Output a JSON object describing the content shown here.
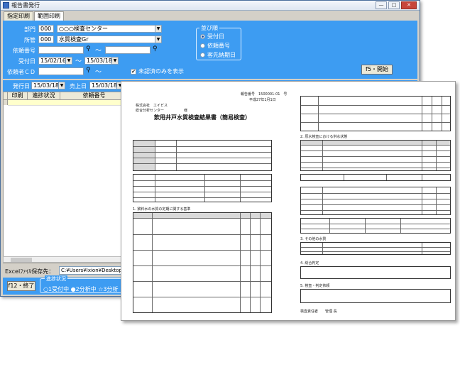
{
  "window": {
    "title": "報告書発行",
    "btn_min": "—",
    "btn_max": "□",
    "btn_close": "✕"
  },
  "tabs": [
    {
      "label": "指定印刷"
    },
    {
      "label": "範囲印刷"
    }
  ],
  "filters": {
    "dept_label": "部門",
    "dept_code": "000",
    "dept_name": "○○○検査センター",
    "section_label": "所管",
    "section_code": "000",
    "section_name": "水質検査Gr",
    "request_no_label": "依頼番号",
    "received_date_label": "受付日",
    "received_from": "15/02/16",
    "received_to": "15/03/18",
    "requester_cd_label": "依頼者ＣＤ",
    "unprinted_only_label": "未認済のみを表示",
    "unprinted_only_checked": "✔",
    "tilde": "〜"
  },
  "sort": {
    "caption": "並び順",
    "options": [
      {
        "label": "受付日",
        "selected": true
      },
      {
        "label": "依頼番号",
        "selected": false
      },
      {
        "label": "客先納期日",
        "selected": false
      }
    ]
  },
  "buttons": {
    "f5": "f5・開始",
    "f12": "f12・終了"
  },
  "strip": {
    "issue_label": "発行日",
    "issue_date": "15/03/18",
    "sales_label": "売上日",
    "sales_date": "15/03/18"
  },
  "grid": {
    "columns": [
      "印刷",
      "進捗状況",
      "依頼番号"
    ]
  },
  "excel": {
    "label": "Excelﾌｧｲﾙ保存先：",
    "path": "C:¥Users¥Ixion¥Desktop"
  },
  "progress": {
    "caption": "進捗状況",
    "text": "○1受付中 ●2分析中 ☆3分析"
  },
  "document": {
    "title": "飲用井戸水質検査結果書（簡易検査）",
    "company_line1": "株式会社　エイビス",
    "company_line2": "総合分析センター",
    "honorific": "様",
    "report_no": "報告番号　1500001-01　号",
    "report_date": "平成27年1月1日",
    "section1": "1. 飲料水の水質の定期に関する基準",
    "section2": "2. 原水検査における供水状態",
    "section3": "3. その他の水質",
    "section4": "4. 総合判定",
    "section5": "5. 検査・判定依頼",
    "footer": "検査責任者　　管理 長"
  },
  "icons": {
    "binoculars": "binoculars-icon",
    "dropdown": "chevron-down-icon"
  }
}
